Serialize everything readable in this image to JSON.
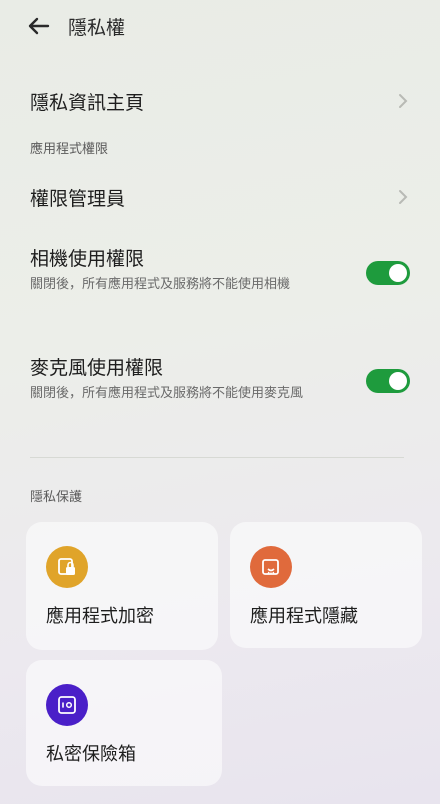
{
  "header": {
    "title": "隱私權",
    "back_icon": "back-arrow-icon"
  },
  "rows": {
    "privacy_home": {
      "label": "隱私資訊主頁"
    },
    "permission_manager": {
      "label": "權限管理員"
    }
  },
  "sections": {
    "app_permissions": "應用程式權限",
    "privacy_protection": "隱私保護"
  },
  "toggles": {
    "camera": {
      "label": "相機使用權限",
      "desc": "關閉後，所有應用程式及服務將不能使用相機",
      "on": true
    },
    "microphone": {
      "label": "麥克風使用權限",
      "desc": "關閉後，所有應用程式及服務將不能使用麥克風",
      "on": true
    }
  },
  "cards": {
    "app_lock": {
      "label": "應用程式加密",
      "icon": "app-lock-icon",
      "color": "#e0a42a"
    },
    "app_hide": {
      "label": "應用程式隱藏",
      "icon": "app-hide-icon",
      "color": "#e06a3c"
    },
    "private_safe": {
      "label": "私密保險箱",
      "icon": "safe-icon",
      "color": "#4a1fc8"
    }
  },
  "colors": {
    "accent": "#1e9b3d"
  }
}
